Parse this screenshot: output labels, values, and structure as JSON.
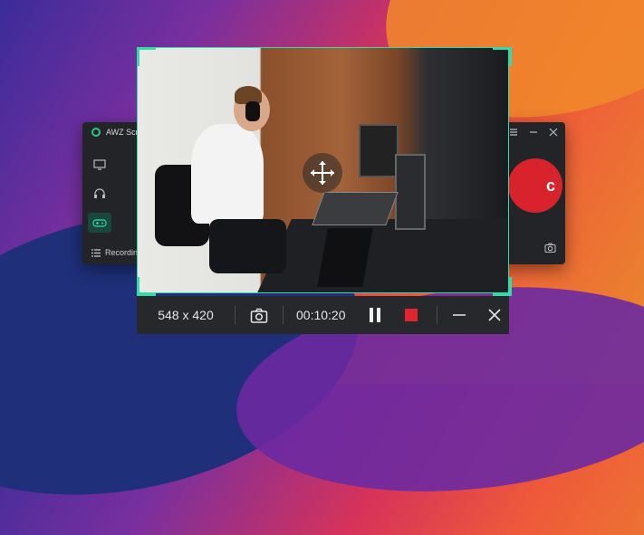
{
  "app": {
    "title": "AWZ Scree",
    "footer_label": "Recording"
  },
  "toolbar": {
    "region_size": "548 x 420",
    "elapsed_time": "00:10:20"
  },
  "colors": {
    "accent": "#2fdcaa",
    "record_red": "#e1242d",
    "toolbar_bg": "#27282c"
  },
  "icons": [
    "screen-icon",
    "headphones-icon",
    "gamepad-icon",
    "list-icon",
    "camera-icon",
    "move-icon",
    "pause-icon",
    "stop-icon",
    "minimize-icon",
    "close-icon"
  ]
}
